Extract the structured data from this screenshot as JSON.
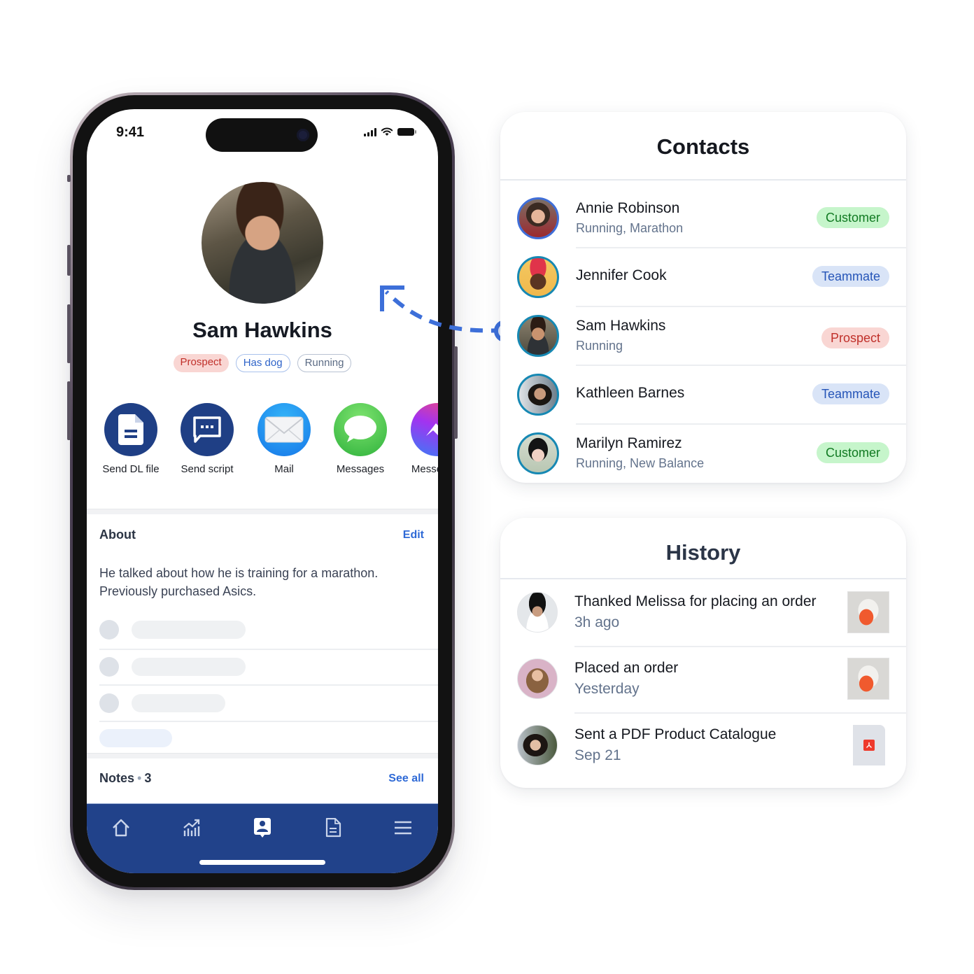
{
  "phone": {
    "status_bar": {
      "time": "9:41"
    },
    "profile": {
      "name": "Sam Hawkins",
      "tags": [
        {
          "label": "Prospect",
          "style": "prospect"
        },
        {
          "label": "Has dog",
          "style": "outline-blue"
        },
        {
          "label": "Running",
          "style": "outline-gray"
        }
      ]
    },
    "actions": [
      {
        "label": "Send DL file",
        "icon": "document-icon"
      },
      {
        "label": "Send script",
        "icon": "chat-script-icon"
      },
      {
        "label": "Mail",
        "icon": "mail-icon"
      },
      {
        "label": "Messages",
        "icon": "messages-icon"
      },
      {
        "label": "Messenger",
        "icon": "messenger-icon"
      }
    ],
    "about": {
      "heading": "About",
      "edit_label": "Edit",
      "text": "He talked about how he is training for a marathon. Previously purchased Asics."
    },
    "notes": {
      "label": "Notes",
      "separator": "•",
      "count": "3",
      "see_all_label": "See all"
    },
    "tabbar": {
      "items": [
        {
          "name": "home",
          "icon": "home-icon",
          "active": false
        },
        {
          "name": "analytics",
          "icon": "chart-growth-icon",
          "active": false
        },
        {
          "name": "contacts",
          "icon": "contact-card-icon",
          "active": true
        },
        {
          "name": "documents",
          "icon": "document-icon",
          "active": false
        },
        {
          "name": "menu",
          "icon": "hamburger-menu-icon",
          "active": false
        }
      ]
    }
  },
  "contacts": {
    "title": "Contacts",
    "items": [
      {
        "name": "Annie Robinson",
        "subtitle": "Running, Marathon",
        "badge": "Customer",
        "badge_type": "customer"
      },
      {
        "name": "Jennifer Cook",
        "subtitle": "",
        "badge": "Teammate",
        "badge_type": "teammate"
      },
      {
        "name": "Sam Hawkins",
        "subtitle": "Running",
        "badge": "Prospect",
        "badge_type": "prospect"
      },
      {
        "name": "Kathleen Barnes",
        "subtitle": "",
        "badge": "Teammate",
        "badge_type": "teammate"
      },
      {
        "name": "Marilyn Ramirez",
        "subtitle": "Running, New Balance",
        "badge": "Customer",
        "badge_type": "customer"
      }
    ]
  },
  "history": {
    "title": "History",
    "items": [
      {
        "title": "Thanked Melissa for placing an order",
        "time": "3h ago",
        "attachment": "sneaker-photo"
      },
      {
        "title": "Placed an order",
        "time": "Yesterday",
        "attachment": "sneaker-photo"
      },
      {
        "title": "Sent a PDF Product Catalogue",
        "time": "Sep 21",
        "attachment": "pdf-file"
      }
    ]
  },
  "colors": {
    "navy": "#21428a",
    "link_blue": "#2f6ad6",
    "connector_blue": "#3d6fd9",
    "customer_bg": "#c6f5cb",
    "customer_fg": "#117a22",
    "teammate_bg": "#d9e4f7",
    "teammate_fg": "#2655b8",
    "prospect_bg": "#f9d6d3",
    "prospect_fg": "#c0302a"
  }
}
